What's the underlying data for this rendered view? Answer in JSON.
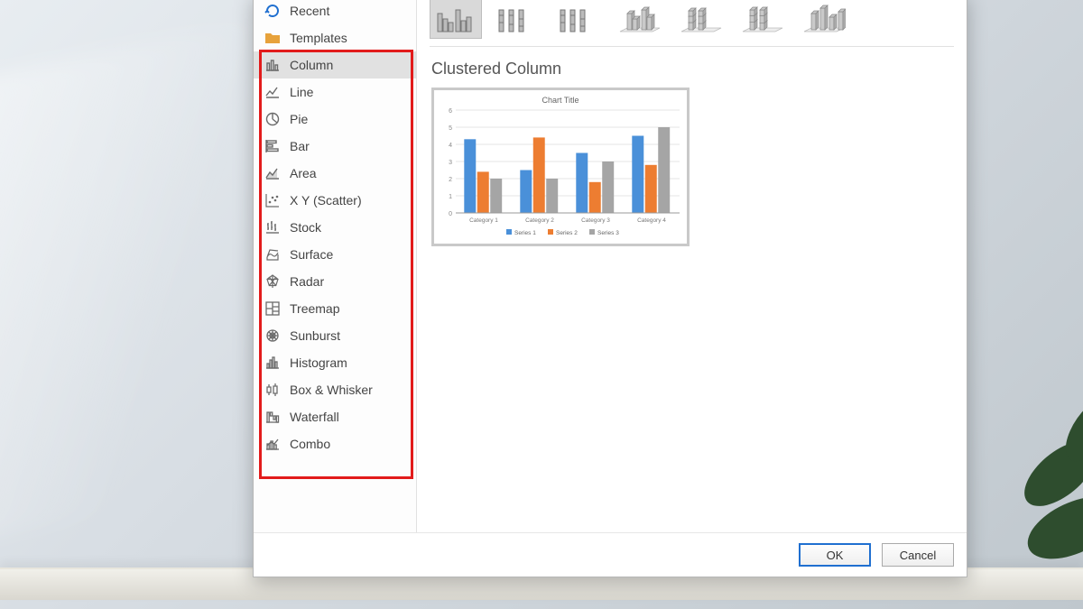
{
  "sidebar": {
    "items": [
      {
        "label": "Recent",
        "icon": "recent"
      },
      {
        "label": "Templates",
        "icon": "folder"
      },
      {
        "label": "Column",
        "icon": "column",
        "selected": true
      },
      {
        "label": "Line",
        "icon": "line"
      },
      {
        "label": "Pie",
        "icon": "pie"
      },
      {
        "label": "Bar",
        "icon": "bar"
      },
      {
        "label": "Area",
        "icon": "area"
      },
      {
        "label": "X Y (Scatter)",
        "icon": "scatter"
      },
      {
        "label": "Stock",
        "icon": "stock"
      },
      {
        "label": "Surface",
        "icon": "surface"
      },
      {
        "label": "Radar",
        "icon": "radar"
      },
      {
        "label": "Treemap",
        "icon": "treemap"
      },
      {
        "label": "Sunburst",
        "icon": "sunburst"
      },
      {
        "label": "Histogram",
        "icon": "histogram"
      },
      {
        "label": "Box & Whisker",
        "icon": "boxwhisker"
      },
      {
        "label": "Waterfall",
        "icon": "waterfall"
      },
      {
        "label": "Combo",
        "icon": "combo"
      }
    ]
  },
  "subtypes": [
    {
      "name": "Clustered Column",
      "icon": "clustered2d",
      "selected": true
    },
    {
      "name": "Stacked Column",
      "icon": "stacked2d"
    },
    {
      "name": "100% Stacked Column",
      "icon": "stacked100_2d"
    },
    {
      "name": "3-D Clustered Column",
      "icon": "clustered3d"
    },
    {
      "name": "3-D Stacked Column",
      "icon": "stacked3d"
    },
    {
      "name": "3-D 100% Stacked Column",
      "icon": "stacked100_3d"
    },
    {
      "name": "3-D Column",
      "icon": "col3d"
    }
  ],
  "main": {
    "chart_type_title": "Clustered Column"
  },
  "preview": {
    "title": "Chart Title",
    "categories": [
      "Category 1",
      "Category 2",
      "Category 3",
      "Category 4"
    ],
    "legend": [
      "Series 1",
      "Series 2",
      "Series 3"
    ]
  },
  "buttons": {
    "ok": "OK",
    "cancel": "Cancel"
  },
  "colors": {
    "accent": "#1f6fd0",
    "highlight": "#e21b1b",
    "series1": "#4a90d9",
    "series2": "#ed7d31",
    "series3": "#a5a5a5"
  },
  "chart_data": {
    "type": "bar",
    "title": "Chart Title",
    "categories": [
      "Category 1",
      "Category 2",
      "Category 3",
      "Category 4"
    ],
    "series": [
      {
        "name": "Series 1",
        "values": [
          4.3,
          2.5,
          3.5,
          4.5
        ]
      },
      {
        "name": "Series 2",
        "values": [
          2.4,
          4.4,
          1.8,
          2.8
        ]
      },
      {
        "name": "Series 3",
        "values": [
          2.0,
          2.0,
          3.0,
          5.0
        ]
      }
    ],
    "xlabel": "",
    "ylabel": "",
    "ylim": [
      0,
      6
    ],
    "legend_position": "bottom",
    "grid": true
  }
}
